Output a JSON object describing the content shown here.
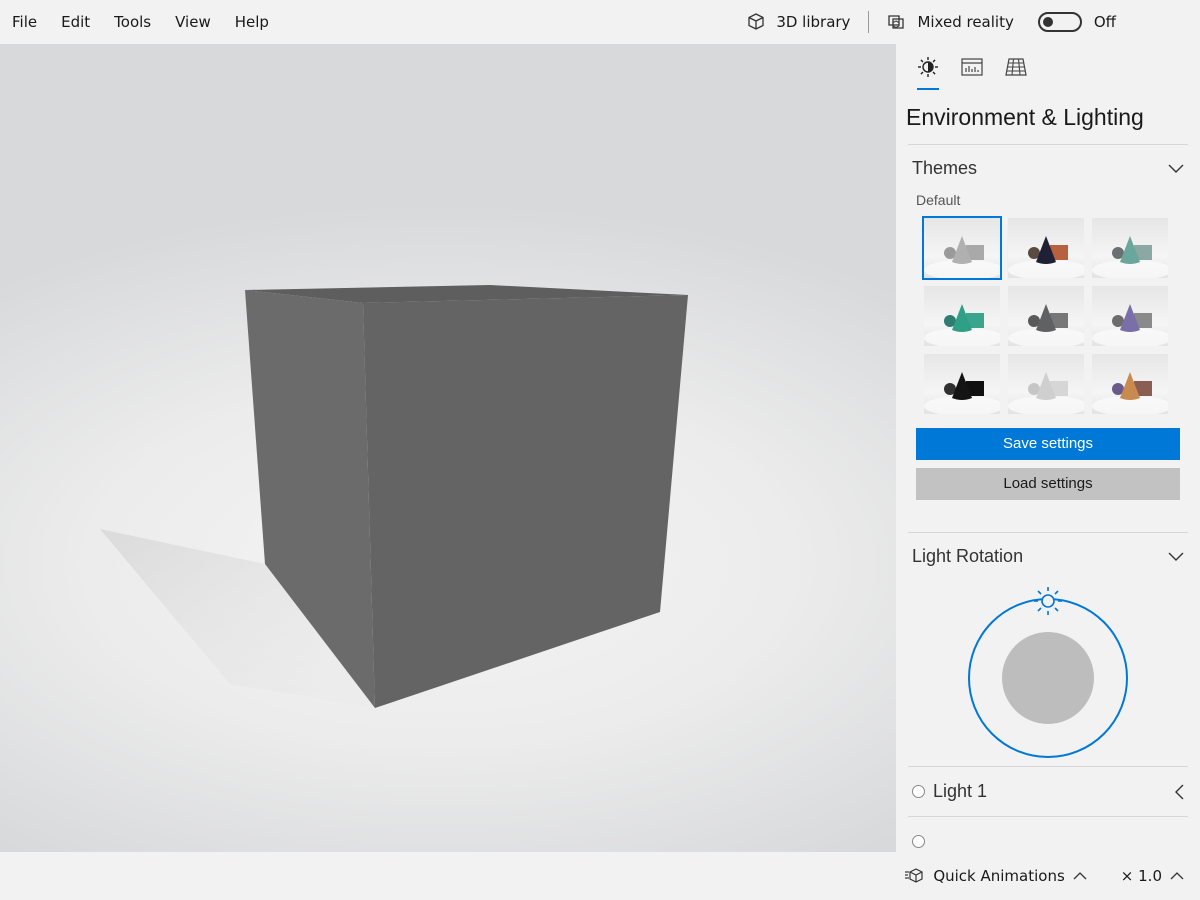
{
  "menu": {
    "items": [
      "File",
      "Edit",
      "Tools",
      "View",
      "Help"
    ]
  },
  "toolbar": {
    "library_label": "3D library",
    "mixed_reality_label": "Mixed reality",
    "mixed_reality_state": "Off"
  },
  "panel": {
    "tabs": [
      "environment-tab",
      "stats-tab",
      "grid-tab"
    ],
    "title": "Environment & Lighting",
    "themes": {
      "header": "Themes",
      "default_label": "Default",
      "tiles": [
        {
          "name": "default",
          "cone": "#b0b0b0",
          "box": "#a9a9a9",
          "sphere": "#9a9a9a"
        },
        {
          "name": "copper",
          "cone": "#1f2035",
          "box": "#b8613f",
          "sphere": "#5a4a40"
        },
        {
          "name": "teal-grey",
          "cone": "#6aa69c",
          "box": "#8ba8a4",
          "sphere": "#6a6f70"
        },
        {
          "name": "teal",
          "cone": "#2fa086",
          "box": "#3aa58c",
          "sphere": "#2f7c70"
        },
        {
          "name": "grey",
          "cone": "#5f6163",
          "box": "#777777",
          "sphere": "#5a5a5a"
        },
        {
          "name": "lavender",
          "cone": "#7a6fa8",
          "box": "#8a8a8a",
          "sphere": "#6c6c6c"
        },
        {
          "name": "black",
          "cone": "#141414",
          "box": "#101010",
          "sphere": "#303030"
        },
        {
          "name": "white",
          "cone": "#cfcfcf",
          "box": "#d6d6d6",
          "sphere": "#c6c6c6"
        },
        {
          "name": "sunset",
          "cone": "#c88a4e",
          "box": "#8a5e52",
          "sphere": "#6a5a8a"
        }
      ]
    },
    "save_label": "Save settings",
    "load_label": "Load settings",
    "light_rotation": {
      "header": "Light Rotation"
    },
    "lights": [
      "Light 1"
    ]
  },
  "statusbar": {
    "animations_label": "Quick Animations",
    "zoom_label": "× 1.0"
  },
  "colors": {
    "accent": "#0078d7",
    "cube_front": "#646464",
    "cube_side": "#6b6b6b",
    "cube_top": "#5e5e5e"
  }
}
